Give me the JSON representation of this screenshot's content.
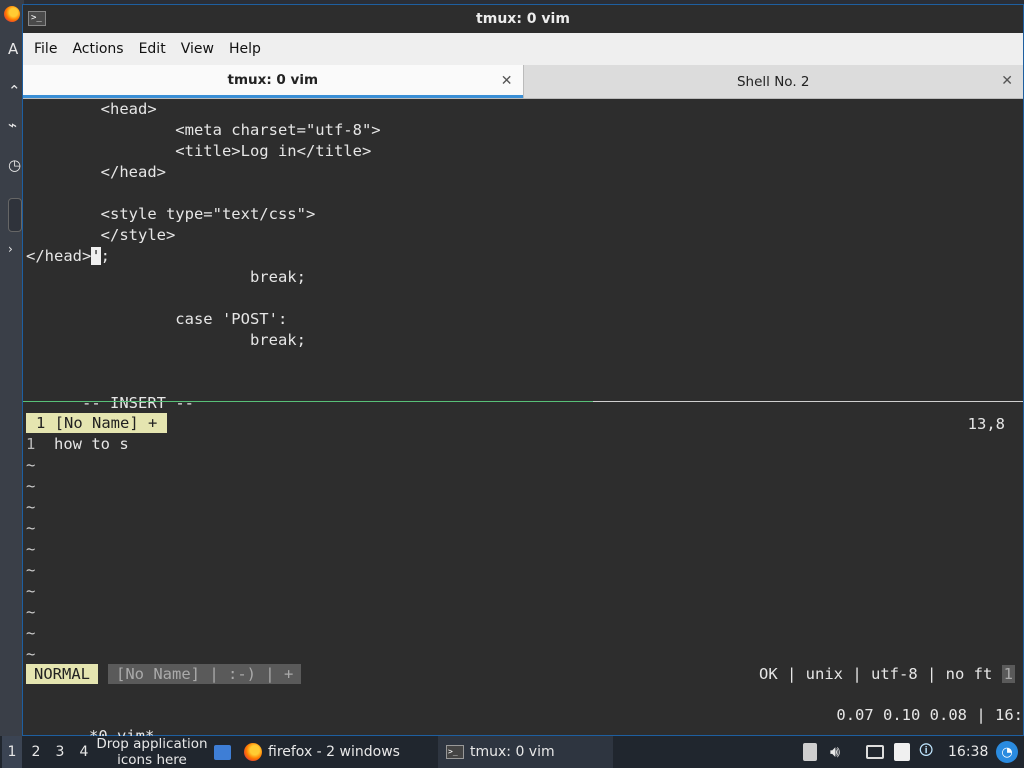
{
  "window": {
    "title": "tmux: 0 vim"
  },
  "menu": [
    "File",
    "Actions",
    "Edit",
    "View",
    "Help"
  ],
  "tabs": [
    {
      "label": "tmux: 0 vim",
      "close": "✕"
    },
    {
      "label": "Shell No. 2",
      "close": "✕"
    }
  ],
  "editor_top": {
    "lines": [
      "        <head>",
      "                <meta charset=\"utf-8\">",
      "                <title>Log in</title>",
      "        </head>",
      "",
      "        <style type=\"text/css\">",
      "        </style>"
    ],
    "cursor_line_before": "</head>",
    "cursor_char": "'",
    "cursor_line_after": ";",
    "lines_after": [
      "                        break;",
      "",
      "                case 'POST':",
      "                        break;"
    ],
    "mode": "-- INSERT --",
    "position": "13,8"
  },
  "editor_bottom": {
    "tabline": "1 [No Name] +",
    "line_number": "1",
    "line_text": "  how to s",
    "tilde": "~",
    "mode": "NORMAL",
    "file_segment": "[No Name] | :-) | +",
    "status_right": "OK | unix | utf-8 | no ft ",
    "status_endcap": "1"
  },
  "tmux": {
    "left": "*0 vim*",
    "right": "0.07 0.10 0.08 | 16:"
  },
  "taskbar": {
    "workspaces": [
      "1",
      "2",
      "3",
      "4"
    ],
    "drop_line1": "Drop application",
    "drop_line2": "icons here",
    "firefox_label": "firefox - 2 windows",
    "tmux_label": "tmux: 0 vim",
    "clock": "16:38"
  },
  "colors": {
    "terminal_bg": "#2d2d2d",
    "terminal_fg": "#e6e6e6",
    "airline_mode": "#e5e5b0",
    "tab_accent": "#3a8fd6",
    "taskbar_bg": "#20262e"
  }
}
